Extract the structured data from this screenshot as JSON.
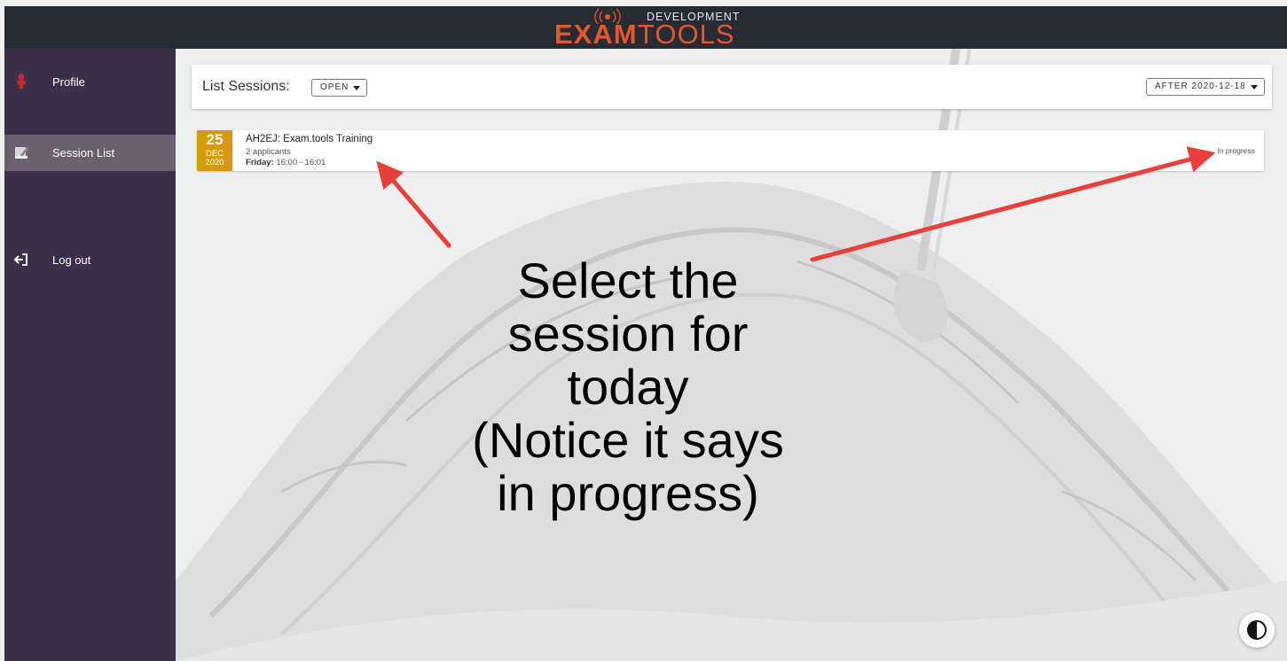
{
  "app": {
    "logo_left": "EXAM",
    "logo_right": "TOOLS",
    "logo_badge": "DEVELOPMENT"
  },
  "sidebar": {
    "items": [
      {
        "label": "Profile",
        "icon": "profile-icon"
      },
      {
        "label": "Session List",
        "icon": "session-list-icon",
        "active": true
      },
      {
        "label": "Log out",
        "icon": "logout-icon"
      }
    ]
  },
  "list": {
    "title": "List Sessions:",
    "status_filter": "OPEN",
    "date_filter": "AFTER 2020-12-18"
  },
  "sessions": [
    {
      "day": "25",
      "month": "DEC",
      "year": "2020",
      "title": "AH2EJ: Exam.tools Training",
      "applicants": "2 applicants",
      "weekday": "Friday:",
      "time": "16:00 - 16:01",
      "status": "In progress"
    }
  ],
  "annotation": {
    "lines": [
      "Select the",
      "session for",
      "today",
      "(Notice it says",
      "in progress)"
    ]
  },
  "colors": {
    "topbar": "#262c34",
    "sidebar": "#3b3049",
    "sidebar_active": "#6a6170",
    "brand": "#e8572b",
    "date_badge": "#d49a0a",
    "arrow": "#e8403b"
  }
}
